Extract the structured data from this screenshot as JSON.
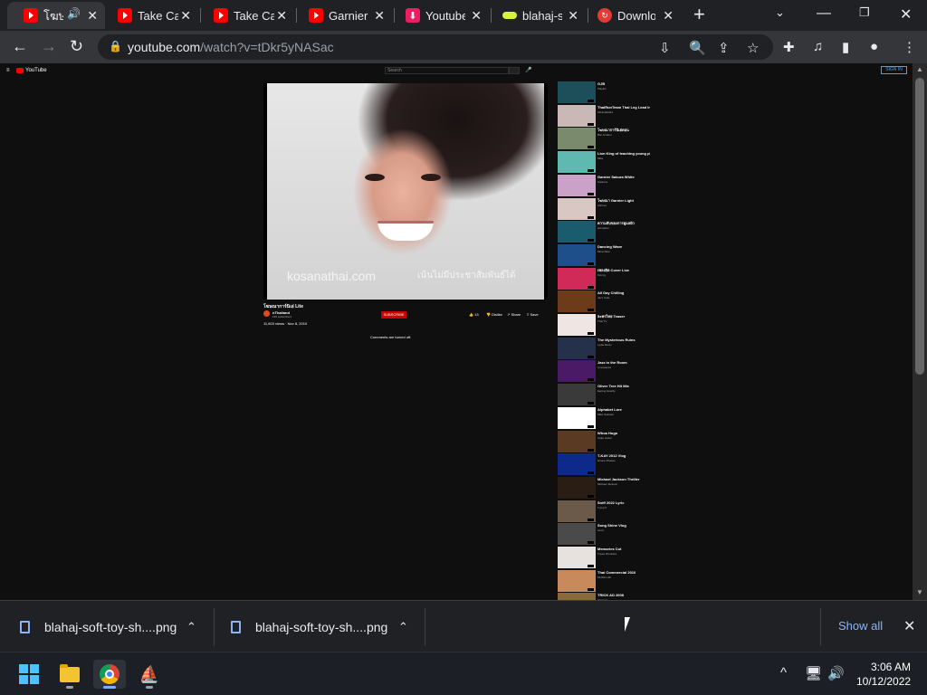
{
  "tabs": [
    {
      "label": "โฆษ",
      "icon": "youtube-icon",
      "audio": true,
      "active": true
    },
    {
      "label": "Take Ca",
      "icon": "youtube-icon"
    },
    {
      "label": "Take Ca",
      "icon": "youtube-icon"
    },
    {
      "label": "Garnier",
      "icon": "youtube-icon"
    },
    {
      "label": "Youtube",
      "icon": "download-icon"
    },
    {
      "label": "blahaj-s",
      "icon": "blahaj-icon"
    },
    {
      "label": "Downlo",
      "icon": "opera-download-icon"
    }
  ],
  "address_bar": {
    "domain": "youtube.com",
    "path": "/watch?v=tDkr5yNASac"
  },
  "youtube": {
    "logo": "YouTube",
    "search_placeholder": "Search",
    "sign_in": "SIGN IN",
    "watermark_left": "kosanathai.com",
    "watermark_right": "เน้นไม่มีประชาสัมพันธ์ได้",
    "video_title": "โฆษณาการ์นิเย่ Lite",
    "channel_name": "nThailand",
    "channel_subs": "165 subscribers",
    "subscribe": "SUBSCRIBE",
    "likes": "13",
    "dislike": "Dislike",
    "share": "Share",
    "save": "Save",
    "views_date": "11,603 views · Nov 8, 2010",
    "comments_off": "Comments are turned off.",
    "recommendations": [
      {
        "title": "GJB",
        "channel": "Playlist",
        "meta": "",
        "color": "#1d4f5a"
      },
      {
        "title": "ThaiRunTeam Thai Leg Lead In Thailand Bits",
        "channel": "Abracadabra",
        "meta": "",
        "color": "#c9b8b6"
      },
      {
        "title": "โฆษณาการ์นิเย่ตอน",
        "channel": "Ban Kraken",
        "meta": "",
        "color": "#7a8a6c"
      },
      {
        "title": "Lion King of teaching young plants",
        "channel": "Mike",
        "meta": "",
        "color": "#5fb9b0"
      },
      {
        "title": "Garnier Sakura White",
        "channel": "Gasteus",
        "meta": "",
        "color": "#caa2c8"
      },
      {
        "title": "โฆษณา Garnier Light",
        "channel": "Clirtnex",
        "meta": "",
        "color": "#d8c7c2"
      },
      {
        "title": "ความลับของการดูแลผิว",
        "channel": "animation",
        "meta": "",
        "color": "#1a5b6e"
      },
      {
        "title": "Dancing Wave",
        "channel": "Mina Slice",
        "meta": "",
        "color": "#1f4f8a"
      },
      {
        "title": "เพลงฮิต Cover Live",
        "channel": "Kimmy",
        "meta": "",
        "color": "#d22a58"
      },
      {
        "title": "All Day Chilling",
        "channel": "Jazz Cafe",
        "meta": "",
        "color": "#6b3b1a"
      },
      {
        "title": "ละครไทย Teaser",
        "channel": "Thai TV",
        "meta": "",
        "color": "#efe6e3"
      },
      {
        "title": "The Mysterious Ruins",
        "channel": "Lydia Music",
        "meta": "",
        "color": "#25314a"
      },
      {
        "title": "Jazz in the Room",
        "channel": "Livespaces",
        "meta": "",
        "color": "#4a1a66"
      },
      {
        "title": "Oliver Tree Hit Mix",
        "channel": "Eeping Heartly",
        "meta": "",
        "color": "#3a3a3a"
      },
      {
        "title": "Alphabet Lore",
        "channel": "Mike Salcedo",
        "meta": "",
        "color": "#ffffff"
      },
      {
        "title": "Whoa Hugo",
        "channel": "Cake Jester",
        "meta": "",
        "color": "#5a3a22"
      },
      {
        "title": "T-KAY 2012 Vlog",
        "channel": "Hirone Phases",
        "meta": "",
        "color": "#0d2a8a"
      },
      {
        "title": "Michael Jackson Thriller",
        "channel": "Michael Jackson",
        "meta": "",
        "color": "#2a1e14"
      },
      {
        "title": "Sniff 2022 Lyric",
        "channel": "T-pop ft",
        "meta": "",
        "color": "#6b5a4a"
      },
      {
        "title": "Song Shine Vlog",
        "channel": "Isrod",
        "meta": "",
        "color": "#4a4a4a"
      },
      {
        "title": "Memories Cut",
        "channel": "Tuyee Rhoades",
        "meta": "",
        "color": "#e8e2df"
      },
      {
        "title": "Thai Commercial 2010",
        "channel": "MUSIC HD",
        "meta": "",
        "color": "#c88a5a"
      },
      {
        "title": "TRICK AD 2008",
        "channel": "Channel",
        "meta": "",
        "color": "#8a6a3a"
      }
    ]
  },
  "downloads": [
    {
      "name": "blahaj-soft-toy-sh....png"
    },
    {
      "name": "blahaj-soft-toy-sh....png"
    }
  ],
  "show_all": "Show all",
  "taskbar": {
    "time": "3:06 AM",
    "date": "10/12/2022"
  }
}
